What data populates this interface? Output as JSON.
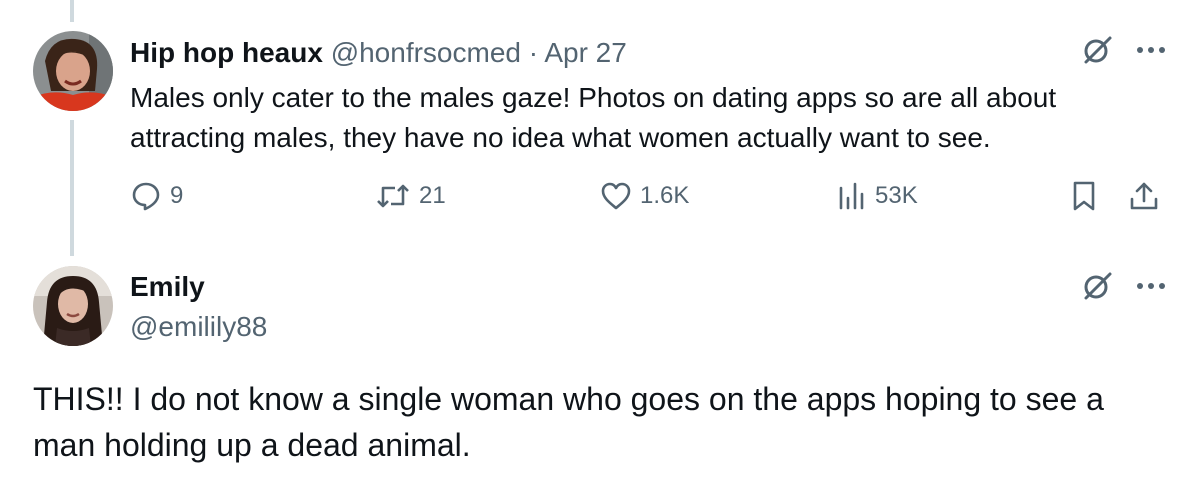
{
  "tweet_1": {
    "display_name": "Hip hop heaux",
    "handle": "@honfrsocmed",
    "separator": "·",
    "date": "Apr 27",
    "text": "Males only cater to the males gaze! Photos on dating apps so are all about attracting males, they have no idea what women actually want to see.",
    "metrics": {
      "replies": "9",
      "retweets": "21",
      "likes": "1.6K",
      "views": "53K"
    }
  },
  "tweet_2": {
    "display_name": "Emily",
    "handle": "@emilily88",
    "text": "THIS!! I do not know a single woman who goes on the apps hoping to see a man holding up a dead animal."
  },
  "icons": {
    "reply": "reply-icon",
    "retweet": "retweet-icon",
    "like": "heart-icon",
    "views": "views-icon",
    "bookmark": "bookmark-icon",
    "share": "share-icon",
    "grok": "grok-icon",
    "more": "more-icon"
  },
  "colors": {
    "text_primary": "#0f1419",
    "text_secondary": "#536471",
    "thread_line": "#cfd9de"
  }
}
